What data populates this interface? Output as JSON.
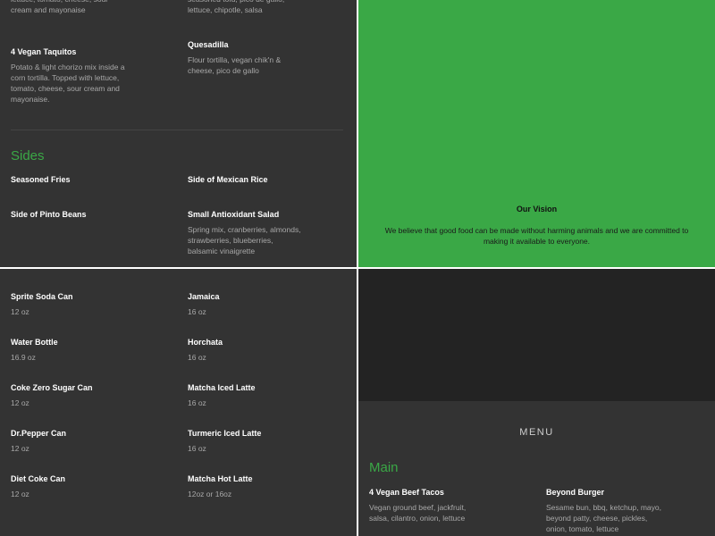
{
  "top_left": {
    "partial_items": [
      {
        "desc": "lettuce, tomato, cheese, sour cream and mayonaise"
      }
    ],
    "items": [
      {
        "name": "4 Vegan Taquitos",
        "desc": "Potato & light chorizo mix inside a corn tortilla. Topped with lettuce, tomato, cheese, sour cream and mayonaise."
      }
    ],
    "right_partial": {
      "desc": "seasoned tofu, pico de gallo, lettuce, chipotle, salsa"
    },
    "right_items": [
      {
        "name": "Quesadilla",
        "desc": "Flour tortilla, vegan chik'n & cheese, pico de gallo"
      }
    ],
    "sides": {
      "title": "Sides",
      "items": [
        {
          "name": "Seasoned Fries",
          "desc": ""
        },
        {
          "name": "Side of Mexican Rice",
          "desc": ""
        },
        {
          "name": "Side of Pinto Beans",
          "desc": ""
        },
        {
          "name": "Small Antioxidant Salad",
          "desc": "Spring mix, cranberries, almonds, strawberries, blueberries, balsamic vinaigrette"
        }
      ]
    }
  },
  "vision": {
    "title": "Our Vision",
    "text": "We believe that good food can be made without harming animals and we are committed to making it available to everyone.",
    "bg_color": "#3aa846"
  },
  "drinks": [
    {
      "name": "Sprite Soda Can",
      "desc": "12 oz"
    },
    {
      "name": "Jamaica",
      "desc": "16 oz"
    },
    {
      "name": "Water Bottle",
      "desc": "16.9 oz"
    },
    {
      "name": "Horchata",
      "desc": "16 oz"
    },
    {
      "name": "Coke Zero Sugar Can",
      "desc": "12 oz"
    },
    {
      "name": "Matcha Iced Latte",
      "desc": "16 oz"
    },
    {
      "name": "Dr.Pepper Can",
      "desc": "12 oz"
    },
    {
      "name": "Turmeric Iced Latte",
      "desc": "16 oz"
    },
    {
      "name": "Diet Coke Can",
      "desc": "12 oz"
    },
    {
      "name": "Matcha Hot Latte",
      "desc": "12oz or 16oz"
    }
  ],
  "menu": {
    "heading": "MENU",
    "main_title": "Main",
    "items": [
      {
        "name": "4 Vegan Beef Tacos",
        "desc": "Vegan ground beef, jackfruit, salsa, cilantro, onion, lettuce"
      },
      {
        "name": "Beyond Burger",
        "desc": "Sesame bun, bbq, ketchup, mayo, beyond patty, cheese, pickles, onion, tomato, lettuce"
      }
    ]
  },
  "colors": {
    "accent": "#3aa846",
    "panel_bg": "#333333",
    "hero_bg": "#232323"
  }
}
